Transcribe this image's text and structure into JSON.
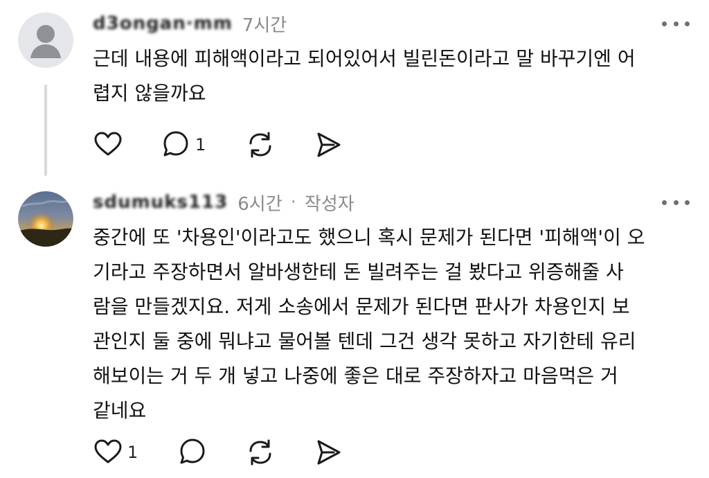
{
  "comments": [
    {
      "username": "d3ongan·mm",
      "time": "7시간",
      "text": "근데 내용에 피해액이라고 되어있어서 빌린돈이라고 말 바꾸기엔 어\n렵지 않을까요",
      "likes": "",
      "replies": "1"
    },
    {
      "username": "sdumuks113",
      "time": "6시간",
      "separator": "·",
      "author_label": "작성자",
      "text": "중간에 또 '차용인'이라고도 했으니 혹시 문제가 된다면 '피해액'이 오\n기라고 주장하면서 알바생한테 돈 빌려주는 걸 봤다고 위증해줄 사\n람을 만들겠지요. 저게 소송에서 문제가 된다면 판사가 차용인지 보\n관인지 둘 중에 뭐냐고 물어볼 텐데 그건 생각 못하고 자기한테 유리\n해보이는 거 두 개 넣고 나중에 좋은 대로 주장하자고 마음먹은 거\n같네요",
      "likes": "1",
      "replies": ""
    }
  ],
  "icons": {
    "like": "heart-icon",
    "reply": "comment-icon",
    "repost": "repost-icon",
    "share": "send-icon",
    "more": "more-dots-icon"
  }
}
